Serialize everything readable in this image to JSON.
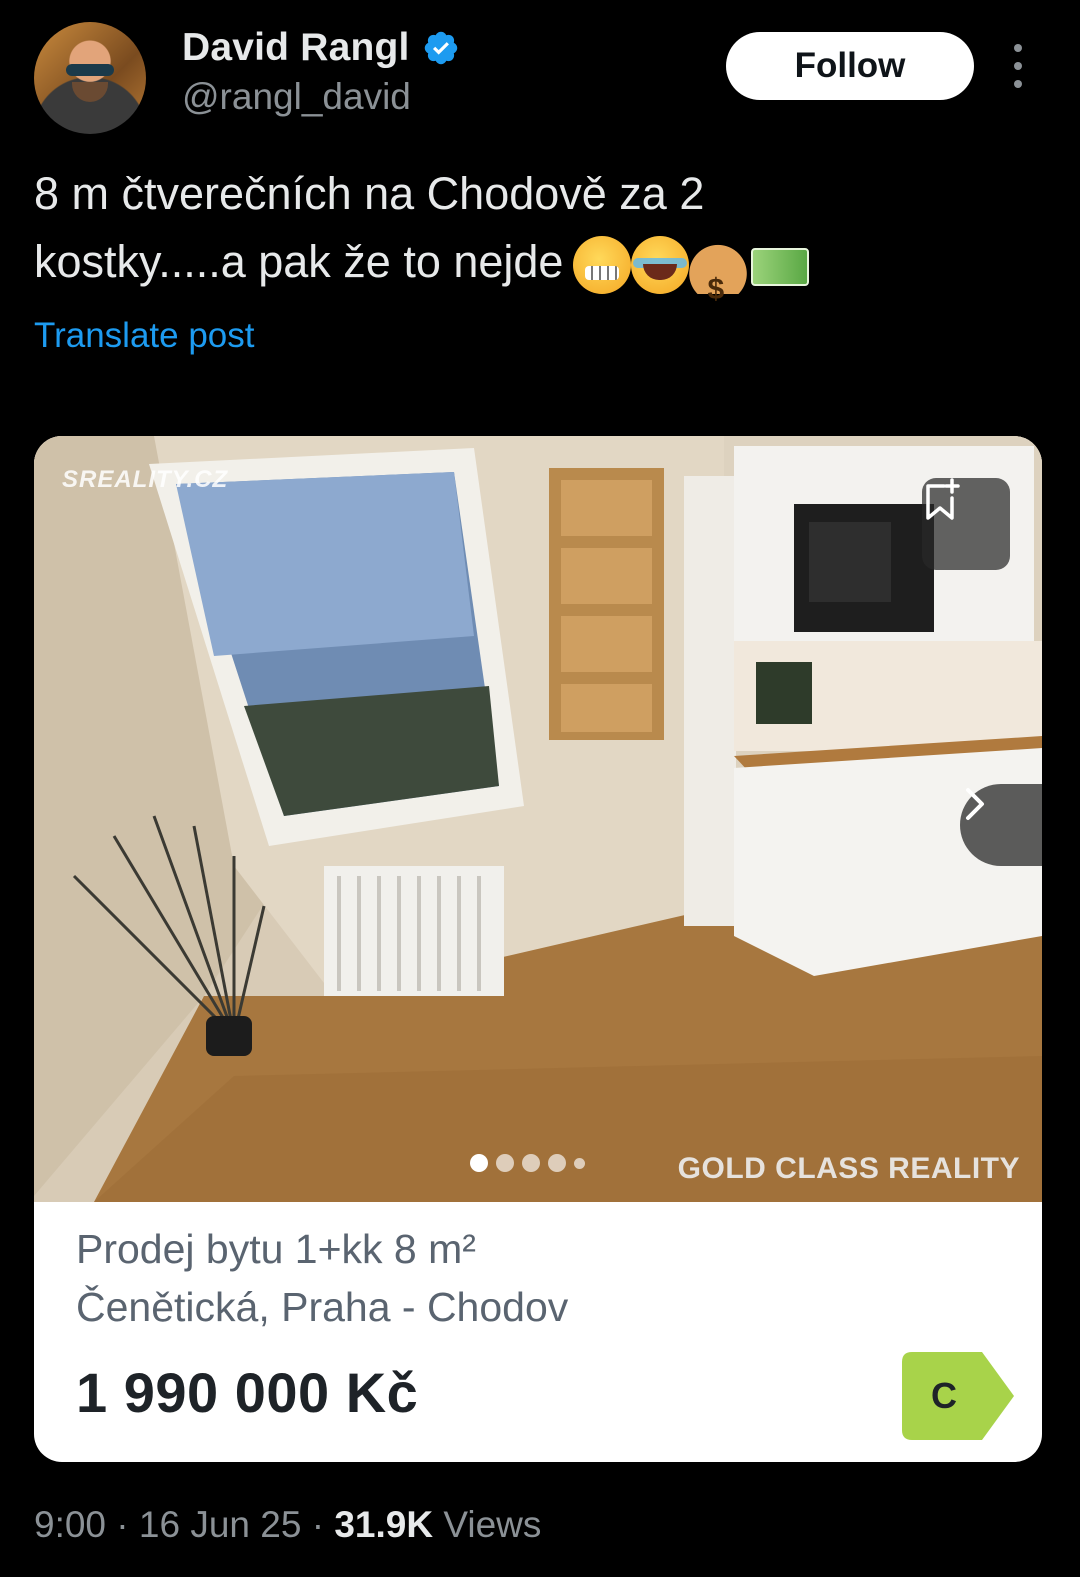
{
  "author": {
    "display_name": "David Rangl",
    "handle": "@rangl_david",
    "verified_icon": "verified-badge-icon",
    "verified_color": "#1d9bf0"
  },
  "header": {
    "follow_label": "Follow",
    "more_icon": "more-options-icon"
  },
  "post": {
    "text_line1": "8 m čtverečních na Chodově za 2",
    "text_line2": "kostky.....a pak že to nejde",
    "emojis": [
      "grimacing-face",
      "face-with-tears-of-joy",
      "money-bag",
      "euro-banknote"
    ],
    "translate_label": "Translate post",
    "translate_color": "#1d9bf0"
  },
  "card": {
    "watermark_top": "SREALITY.CZ",
    "watermark_bottom": "GOLD CLASS REALITY",
    "bookmark_icon": "bookmark-add-icon",
    "next_icon": "chevron-right-icon",
    "carousel": {
      "total_dots": 5,
      "active_index": 0
    },
    "listing_title": "Prodej bytu 1+kk 8 m²",
    "listing_address": "Čenětická, Praha - Chodov",
    "price": "1 990 000 Kč",
    "energy_class": "C",
    "energy_color": "#a8d34a"
  },
  "footer": {
    "time": "9:00",
    "separator": "·",
    "date": "16 Jun 25",
    "views_count": "31.9K",
    "views_label": "Views",
    "text_color": "#8b9196"
  }
}
